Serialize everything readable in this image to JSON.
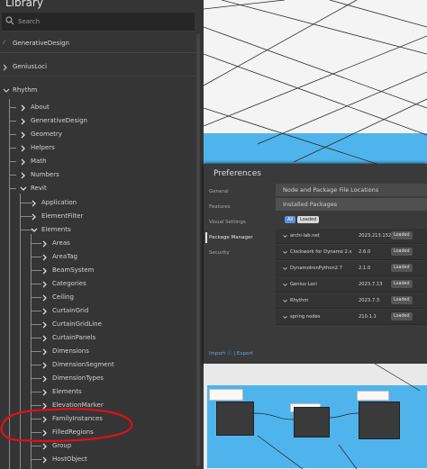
{
  "library": {
    "title": "Library",
    "search": {
      "placeholder": "Search"
    },
    "top_items": [
      {
        "label": "GenerativeDesign"
      },
      {
        "label": "GeniusLoci"
      },
      {
        "label": "Rhythm"
      }
    ],
    "rhythm_children": [
      "About",
      "GenerativeDesign",
      "Geometry",
      "Helpers",
      "Math",
      "Numbers",
      "Revit"
    ],
    "revit_children": [
      "Application",
      "ElementFilter",
      "Elements"
    ],
    "elements_children": [
      "Areas",
      "AreaTag",
      "BeamSystem",
      "Categories",
      "Ceiling",
      "CurtainGrid",
      "CurtainGridLine",
      "CurtainPanels",
      "Dimensions",
      "DimensionSegment",
      "DimensionTypes",
      "Elements",
      "ElevationMarker",
      "FamilyInstances",
      "FilledRegions",
      "Group",
      "HostObject"
    ]
  },
  "preferences": {
    "title": "Preferences",
    "nav": [
      "General",
      "Features",
      "Visual Settings",
      "Package Manager",
      "Security"
    ],
    "active_nav": "Package Manager",
    "sections": {
      "locations": "Node and Package File Locations",
      "installed": "Installed Packages"
    },
    "filters": {
      "all": "All",
      "loaded": "Loaded"
    },
    "packages": [
      {
        "name": "archi-lab.net",
        "version": "2023.213.1523",
        "status": "Loaded"
      },
      {
        "name": "Clockwork for Dynamo 2.x",
        "version": "2.6.0",
        "status": "Loaded"
      },
      {
        "name": "DynamoIronPython2.7",
        "version": "2.1.0",
        "status": "Loaded"
      },
      {
        "name": "Genius Loci",
        "version": "2023.7.13",
        "status": "Loaded"
      },
      {
        "name": "Rhythm",
        "version": "2023.7.3",
        "status": "Loaded"
      },
      {
        "name": "spring nodes",
        "version": "210.1.1",
        "status": "Loaded"
      }
    ],
    "import_export": "Import ⓘ | Export"
  },
  "colors": {
    "panel": "#353535",
    "accent_blue": "#4fb4ec",
    "annotation_red": "#e0101a"
  }
}
